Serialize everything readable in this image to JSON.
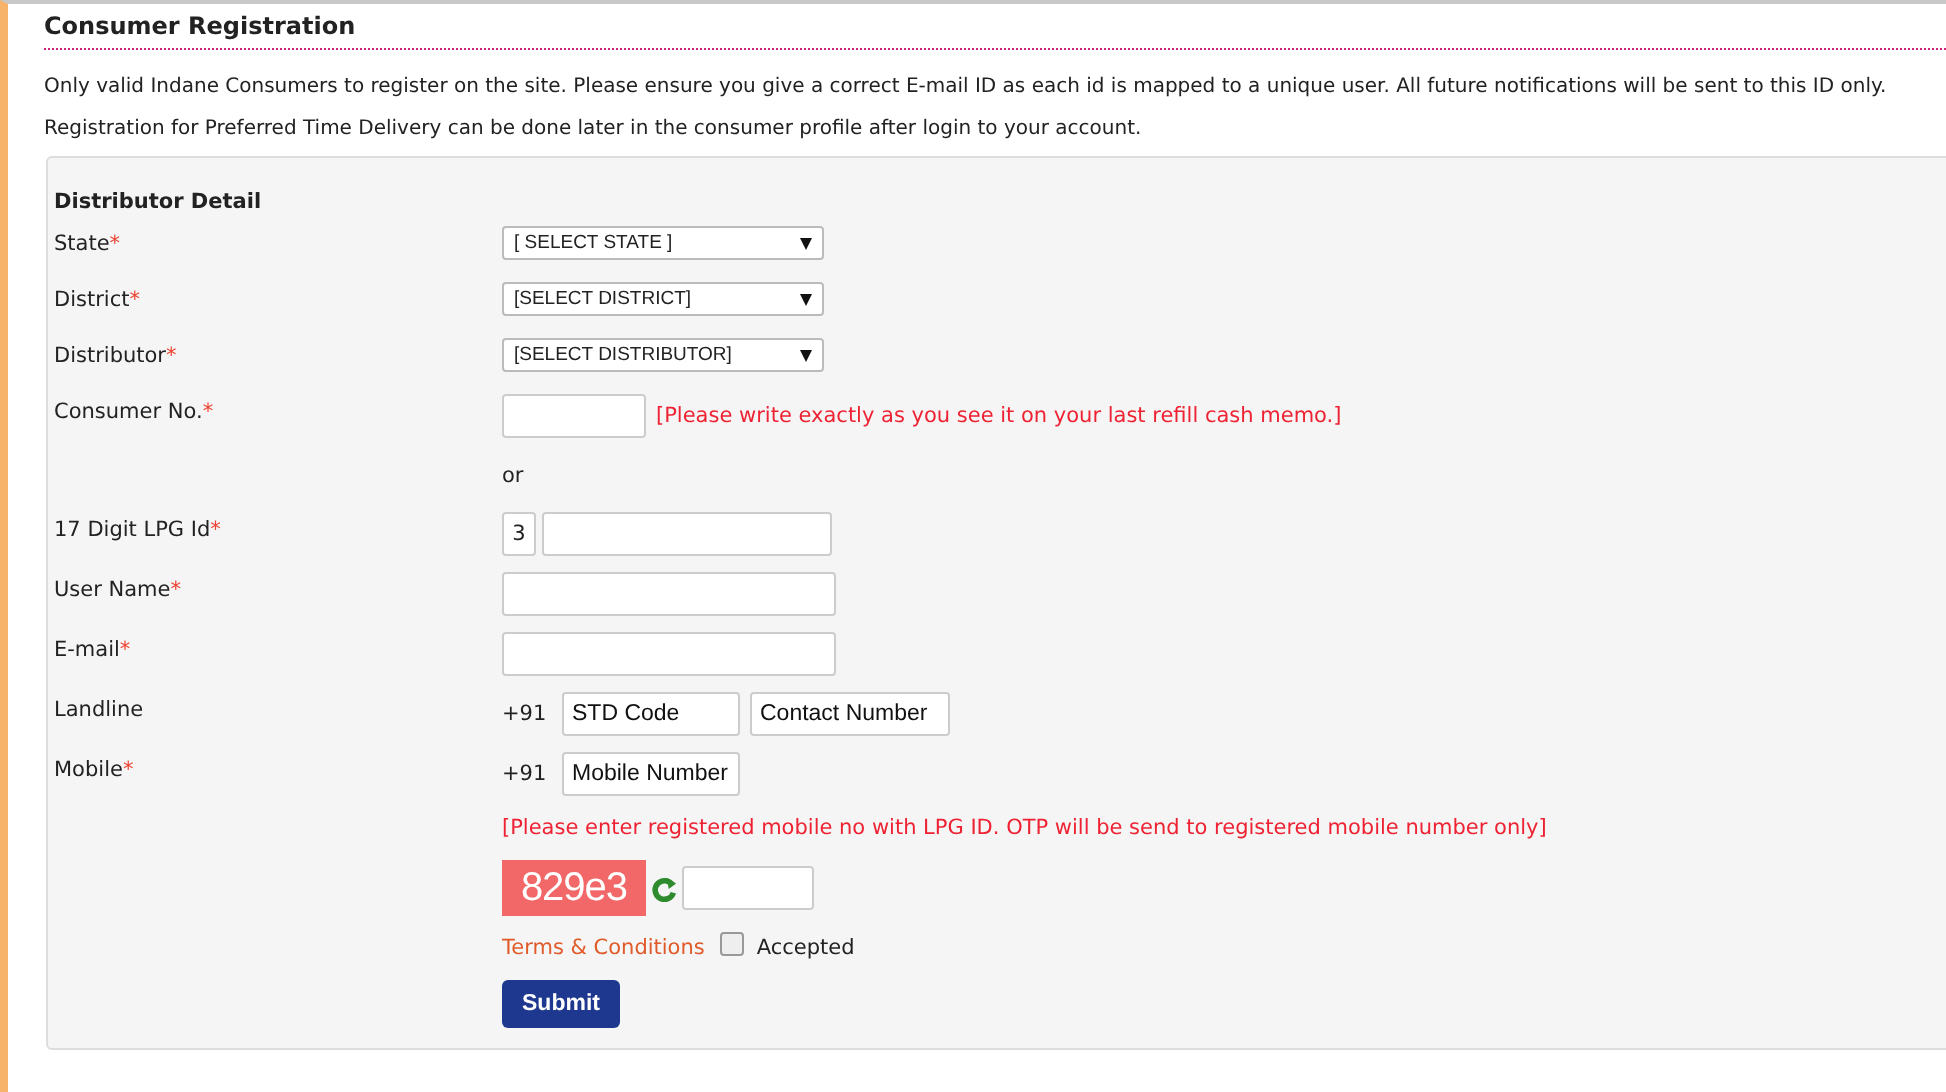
{
  "title": "Consumer Registration",
  "notes": [
    "Only valid Indane Consumers to register on the site. Please ensure you give a correct E-mail ID as each id is mapped to a unique user. All future notifications will be sent to this ID only.",
    "Registration for Preferred Time Delivery can be done later in the consumer profile after login to your account."
  ],
  "section": "Distributor Detail",
  "fields": [
    {
      "kind": "select",
      "label": "State",
      "mark": "*",
      "value": "[ SELECT STATE ]"
    },
    {
      "kind": "select",
      "label": "District",
      "mark": "*",
      "value": "[SELECT DISTRICT]"
    },
    {
      "kind": "select",
      "label": "Distributor",
      "mark": "*",
      "value": "[SELECT DISTRIBUTOR]"
    },
    {
      "kind": "hinted",
      "label": "Consumer No.",
      "mark": "*",
      "hint": "[Please write exactly as you see it on your last refill cash memo.]"
    },
    {
      "kind": "separator",
      "text": "or"
    },
    {
      "kind": "lpg",
      "label": "17 Digit LPG Id",
      "mark": "*",
      "prefix": "3"
    },
    {
      "kind": "text",
      "label": "User Name",
      "mark": "*"
    },
    {
      "kind": "text",
      "label": "E-mail",
      "mark": "*"
    },
    {
      "kind": "phone",
      "label": "Landline",
      "code": "+91",
      "inputs": [
        {
          "placeholder": "STD Code"
        },
        {
          "placeholder": "Contact Number"
        }
      ]
    },
    {
      "kind": "phone",
      "label": "Mobile",
      "mark": "*",
      "code": "+91",
      "inputs": [
        {
          "placeholder": "Mobile Number"
        }
      ]
    },
    {
      "kind": "notice",
      "text": "[Please enter registered mobile no with LPG ID. OTP will be send to registered mobile number only]"
    },
    {
      "kind": "captcha",
      "code": "829e3"
    }
  ],
  "terms": {
    "link": "Terms & Conditions",
    "label": "Accepted",
    "checked": false
  },
  "submit": "Submit"
}
